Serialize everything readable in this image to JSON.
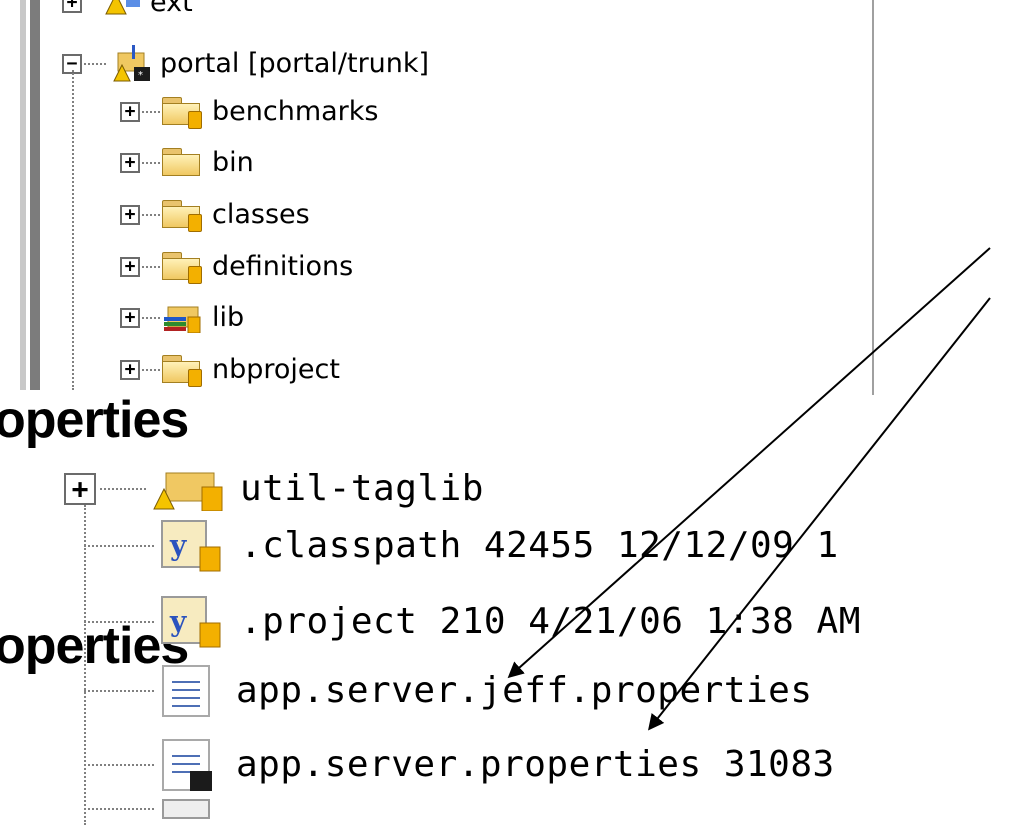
{
  "top_tree": {
    "partial_top_label": "ext",
    "project": "portal [portal/trunk]",
    "children": [
      "benchmarks",
      "bin",
      "classes",
      "definitions",
      "lib",
      "nbproject"
    ]
  },
  "overlay": {
    "title_a": "operties",
    "title_b": "operties"
  },
  "bottom_tree": {
    "util_taglib": "util-taglib",
    "classpath": ".classpath 42455  12/12/09 1",
    "project": ".project 210  4/21/06 1:38 AM",
    "jeff_props": "app.server.jeff.properties",
    "server_props": "app.server.properties 31083"
  },
  "colors": {
    "folder": "#f0c862",
    "can": "#f3b000",
    "doc_lines": "#4e6fb5"
  },
  "icons": {
    "warning": "warning-icon",
    "folder": "folder-icon",
    "library": "library-icon",
    "xml": "xml-file-icon",
    "doc": "properties-file-icon"
  }
}
